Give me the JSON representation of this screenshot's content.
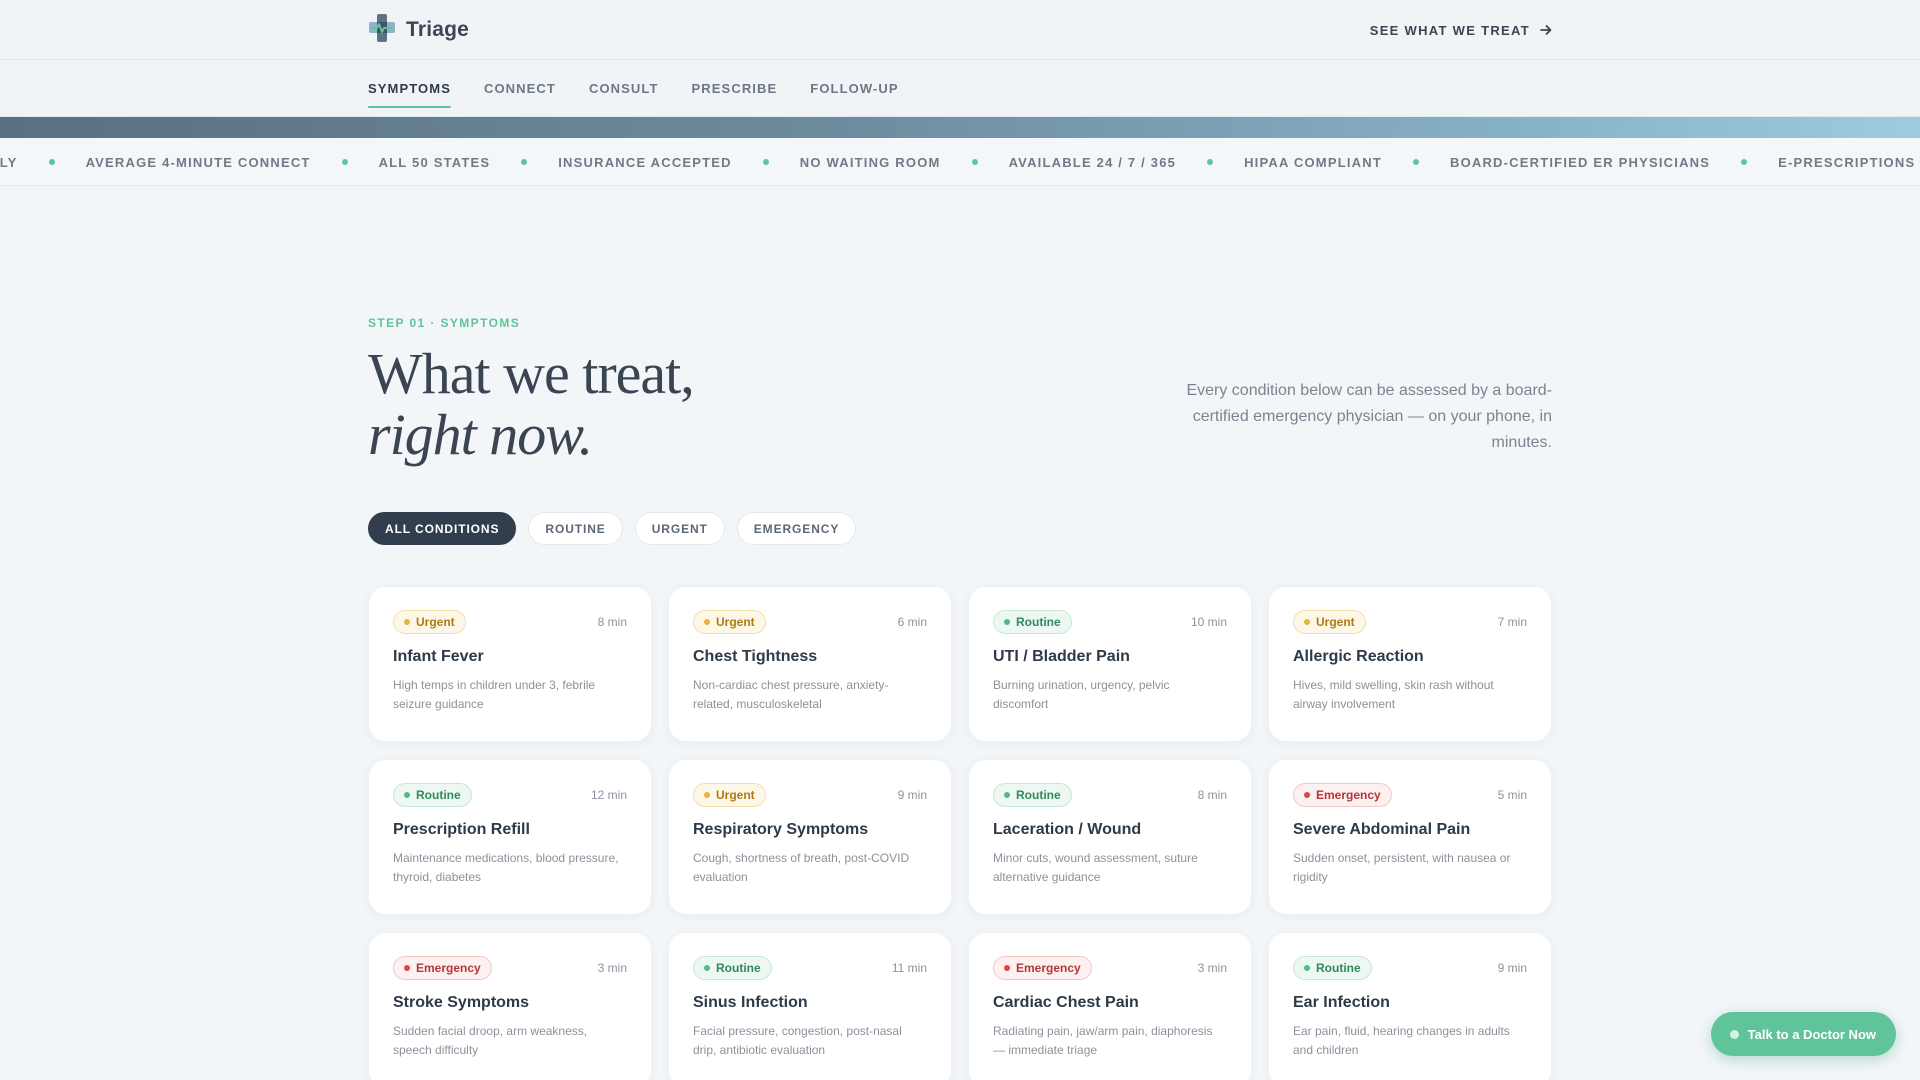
{
  "header": {
    "brand_name": "Triage",
    "logo_icon": "medical-cross-icon",
    "see_link_label": "SEE WHAT WE TREAT",
    "see_link_icon": "arrow-right-icon"
  },
  "tabs": [
    {
      "label": "SYMPTOMS",
      "active": true
    },
    {
      "label": "CONNECT",
      "active": false
    },
    {
      "label": "CONSULT",
      "active": false
    },
    {
      "label": "PRESCRIBE",
      "active": false
    },
    {
      "label": "FOLLOW-UP",
      "active": false
    }
  ],
  "ticker": [
    "NTLY",
    "AVERAGE 4-MINUTE CONNECT",
    "ALL 50 STATES",
    "INSURANCE ACCEPTED",
    "NO WAITING ROOM",
    "AVAILABLE 24 / 7 / 365",
    "HIPAA COMPLIANT",
    "BOARD-CERTIFIED ER PHYSICIANS",
    "E-PRESCRIPTIONS SENT INSTANTLY"
  ],
  "hero": {
    "step_label": "STEP 01 · SYMPTOMS",
    "title_line1": "What we treat,",
    "title_line2": "right now.",
    "description": "Every condition below can be assessed by a board-certified emergency physician — on your phone, in minutes."
  },
  "filters": [
    {
      "label": "ALL CONDITIONS",
      "active": true
    },
    {
      "label": "ROUTINE",
      "active": false
    },
    {
      "label": "URGENT",
      "active": false
    },
    {
      "label": "EMERGENCY",
      "active": false
    }
  ],
  "conditions": [
    {
      "level": "Urgent",
      "type": "urgent",
      "duration": "8 min",
      "title": "Infant Fever",
      "desc": "High temps in children under 3, febrile seizure guidance"
    },
    {
      "level": "Urgent",
      "type": "urgent",
      "duration": "6 min",
      "title": "Chest Tightness",
      "desc": "Non-cardiac chest pressure, anxiety-related, musculoskeletal"
    },
    {
      "level": "Routine",
      "type": "routine",
      "duration": "10 min",
      "title": "UTI / Bladder Pain",
      "desc": "Burning urination, urgency, pelvic discomfort"
    },
    {
      "level": "Urgent",
      "type": "urgent",
      "duration": "7 min",
      "title": "Allergic Reaction",
      "desc": "Hives, mild swelling, skin rash without airway involvement"
    },
    {
      "level": "Routine",
      "type": "routine",
      "duration": "12 min",
      "title": "Prescription Refill",
      "desc": "Maintenance medications, blood pressure, thyroid, diabetes"
    },
    {
      "level": "Urgent",
      "type": "urgent",
      "duration": "9 min",
      "title": "Respiratory Symptoms",
      "desc": "Cough, shortness of breath, post-COVID evaluation"
    },
    {
      "level": "Routine",
      "type": "routine",
      "duration": "8 min",
      "title": "Laceration / Wound",
      "desc": "Minor cuts, wound assessment, suture alternative guidance"
    },
    {
      "level": "Emergency",
      "type": "emergency",
      "duration": "5 min",
      "title": "Severe Abdominal Pain",
      "desc": "Sudden onset, persistent, with nausea or rigidity"
    },
    {
      "level": "Emergency",
      "type": "emergency",
      "duration": "3 min",
      "title": "Stroke Symptoms",
      "desc": "Sudden facial droop, arm weakness, speech difficulty"
    },
    {
      "level": "Routine",
      "type": "routine",
      "duration": "11 min",
      "title": "Sinus Infection",
      "desc": "Facial pressure, congestion, post-nasal drip, antibiotic evaluation"
    },
    {
      "level": "Emergency",
      "type": "emergency",
      "duration": "3 min",
      "title": "Cardiac Chest Pain",
      "desc": "Radiating pain, jaw/arm pain, diaphoresis — immediate triage"
    },
    {
      "level": "Routine",
      "type": "routine",
      "duration": "9 min",
      "title": "Ear Infection",
      "desc": "Ear pain, fluid, hearing changes in adults and children"
    }
  ],
  "cta": {
    "label": "Talk to a Doctor Now"
  },
  "colors": {
    "accent_green": "#5fc49a",
    "dark_navy": "#323e4d",
    "urgent": "#e9b23a",
    "routine": "#4dbb84",
    "emergency": "#d54848"
  }
}
